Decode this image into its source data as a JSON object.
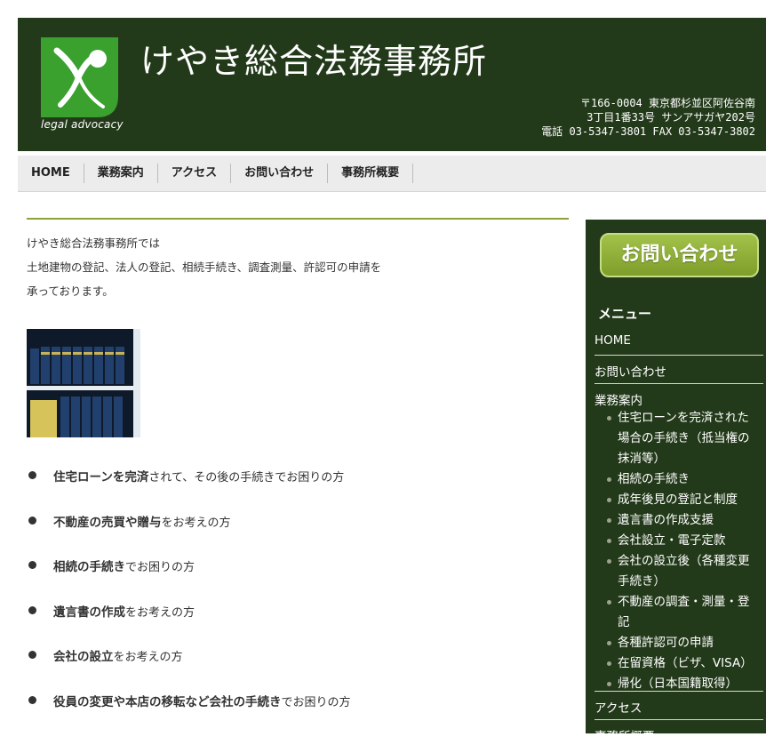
{
  "header": {
    "title": "けやき総合法務事務所",
    "logo_text": "legal advocacy",
    "address_line1": "〒166-0004 東京都杉並区阿佐谷南",
    "address_line2": "3丁目1番33号 サンアサガヤ202号",
    "address_line3": "電話 03-5347-3801 FAX 03-5347-3802",
    "colors": {
      "header_bg": "#233a1a",
      "logo_green": "#3aa02e"
    }
  },
  "nav": {
    "items": [
      "HOME",
      "業務案内",
      "アクセス",
      "お問い合わせ",
      "事務所概要"
    ]
  },
  "main": {
    "intro_line1": "けやき総合法務事務所では",
    "intro_line2": "土地建物の登記、法人の登記、相続手続き、調査測量、許認可の申請を",
    "intro_line3": "承っております。",
    "features": [
      {
        "bold": "住宅ローンを完済",
        "rest": "されて、その後の手続きでお困りの方"
      },
      {
        "bold": "不動産の売買や贈与",
        "rest": "をお考えの方"
      },
      {
        "bold": "相続の手続き",
        "rest": "でお困りの方"
      },
      {
        "bold": "遺言書の作成",
        "rest": "をお考えの方"
      },
      {
        "bold": "会社の設立",
        "rest": "をお考えの方"
      },
      {
        "bold": "役員の変更や本店の移転など会社の手続き",
        "rest": "でお困りの方"
      }
    ]
  },
  "sidebar": {
    "contact_button": "お問い合わせ",
    "menu_title": "メニュー",
    "home": "HOME",
    "contact": "お問い合わせ",
    "services": "業務案内",
    "service_items": [
      "住宅ローンを完済された場合の手続き（抵当権の抹消等）",
      "相続の手続き",
      "成年後見の登記と制度",
      "遺言書の作成支援",
      "会社設立・電子定款",
      "会社の設立後（各種変更手続き）",
      "不動産の調査・測量・登記",
      "各種許認可の申請",
      "在留資格（ビザ、VISA）",
      "帰化（日本国籍取得）"
    ],
    "access": "アクセス",
    "about": "事務所概要"
  }
}
